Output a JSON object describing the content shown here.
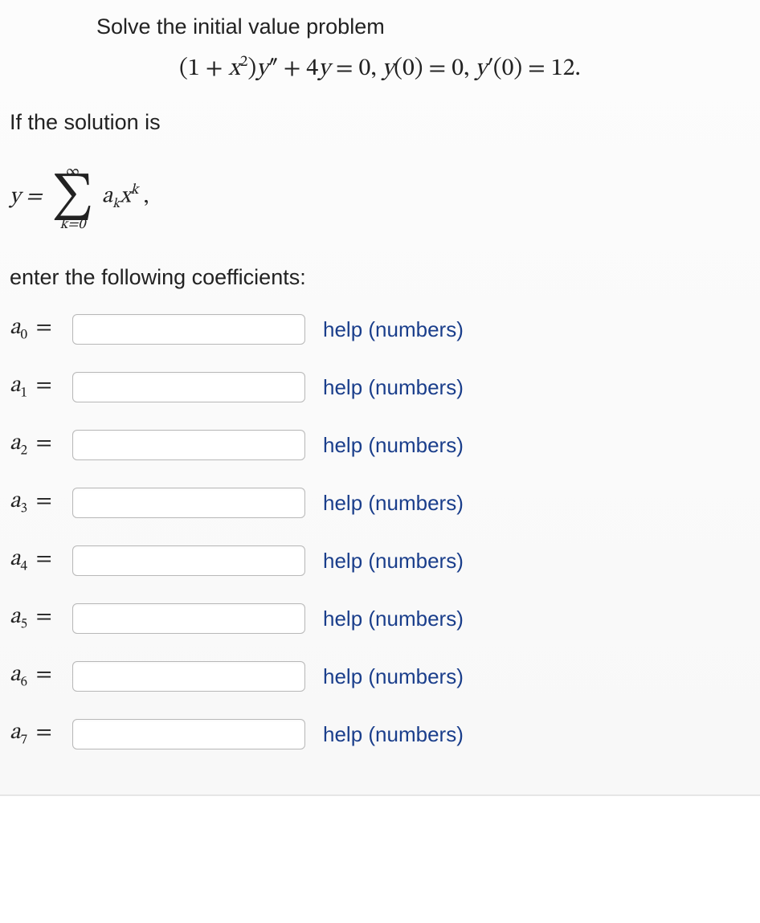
{
  "intro": "Solve the initial value problem",
  "equation": {
    "lhs_coeff_open": "(1 + ",
    "lhs_var": "x",
    "lhs_exp": "2",
    "lhs_coeff_close": ")",
    "y": "y",
    "dprime": "″",
    "plus": " + 4",
    "y2": "y",
    "eq": " = 0, ",
    "ic1_y": "y",
    "ic1": "(0) = 0, ",
    "ic2_y": "y",
    "ic2_prime": "′",
    "ic2": "(0) = 12."
  },
  "if_solution": "If the solution is",
  "series": {
    "lhs": "y = ",
    "upper": "∞",
    "lower": "k=0",
    "a": "a",
    "sub": "k",
    "x": "x",
    "sup": "k",
    "trail": ","
  },
  "enter_prompt": "enter the following coefficients:",
  "help_text": "help (numbers)",
  "coeffs": [
    {
      "name": "a",
      "index": "0"
    },
    {
      "name": "a",
      "index": "1"
    },
    {
      "name": "a",
      "index": "2"
    },
    {
      "name": "a",
      "index": "3"
    },
    {
      "name": "a",
      "index": "4"
    },
    {
      "name": "a",
      "index": "5"
    },
    {
      "name": "a",
      "index": "6"
    },
    {
      "name": "a",
      "index": "7"
    }
  ]
}
